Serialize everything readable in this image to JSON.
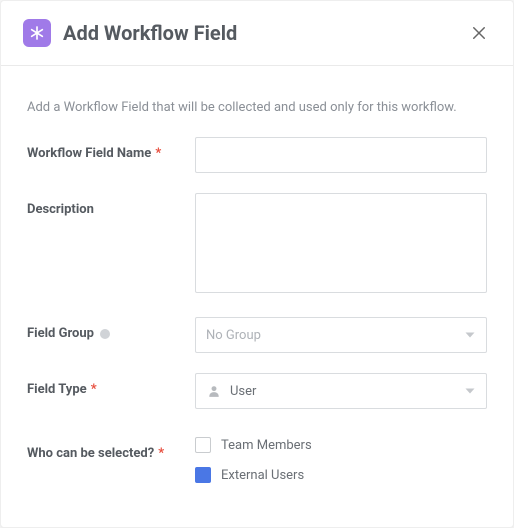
{
  "header": {
    "title": "Add Workflow Field"
  },
  "intro": "Add a Workflow Field that will be collected and used only for this workflow.",
  "labels": {
    "name": "Workflow Field Name",
    "description": "Description",
    "group": "Field Group",
    "type": "Field Type",
    "who": "Who can be selected?",
    "required_mark": "*"
  },
  "fields": {
    "name": {
      "value": "",
      "placeholder": ""
    },
    "description": {
      "value": "",
      "placeholder": ""
    },
    "group": {
      "selected": "No Group",
      "has_value": false
    },
    "type": {
      "selected": "User",
      "has_value": true,
      "icon": "user-icon"
    }
  },
  "who_options": [
    {
      "label": "Team Members",
      "checked": false
    },
    {
      "label": "External Users",
      "checked": true
    }
  ]
}
